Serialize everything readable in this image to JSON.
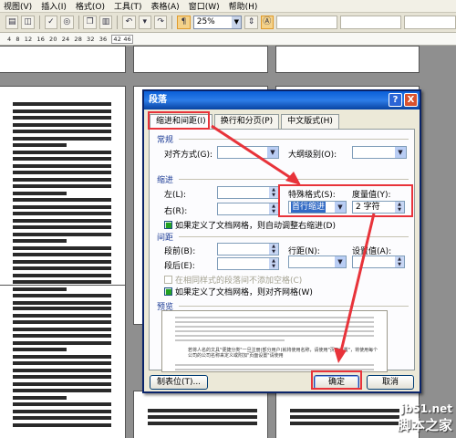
{
  "menu": [
    "视图(V)",
    "插入(I)",
    "格式(O)",
    "工具(T)",
    "表格(A)",
    "窗口(W)",
    "帮助(H)"
  ],
  "toolbar": {
    "zoom": "25%"
  },
  "ruler": {
    "marks": [
      "4",
      "8",
      "12",
      "16",
      "20",
      "24",
      "28",
      "32",
      "36"
    ],
    "highlight": "42 46"
  },
  "dialog": {
    "title": "段落",
    "help": "?",
    "close": "X",
    "tabs": [
      "缩进和间距(I)",
      "换行和分页(P)",
      "中文版式(H)"
    ],
    "general": {
      "section": "常规",
      "align_label": "对齐方式(G):",
      "outline_label": "大纲级别(O):"
    },
    "indent": {
      "section": "缩进",
      "left_label": "左(L):",
      "right_label": "右(R):",
      "special_label": "特殊格式(S):",
      "special_value": "首行缩进",
      "measure_label": "度量值(Y):",
      "measure_value": "2 字符",
      "grid_check": "如果定义了文档网格，则自动调整右缩进(D)"
    },
    "spacing": {
      "section": "间距",
      "before_label": "段前(B):",
      "after_label": "段后(E):",
      "line_label": "行距(N):",
      "setvalue_label": "设置值(A):",
      "same_style_check": "在相同样式的段落间不添加空格(C)",
      "grid_align_check": "如果定义了文档网格，则对齐网格(W)"
    },
    "preview": {
      "section": "预览",
      "sample": "若将人名的文具\"便捷分类\"一旦注册(部分用户)就将使用名称，请使用\"页面设置\"，将使用每个公司的公司名称来定义或附加\"页面设置\"请使用"
    },
    "buttons": {
      "tabs": "制表位(T)...",
      "ok": "确定",
      "cancel": "取消"
    }
  },
  "watermark": {
    "line1": "jb51.net",
    "line2": "脚本之家"
  },
  "colors": {
    "annotation": "#e8333a",
    "titlebar": "#0a5fd8"
  }
}
